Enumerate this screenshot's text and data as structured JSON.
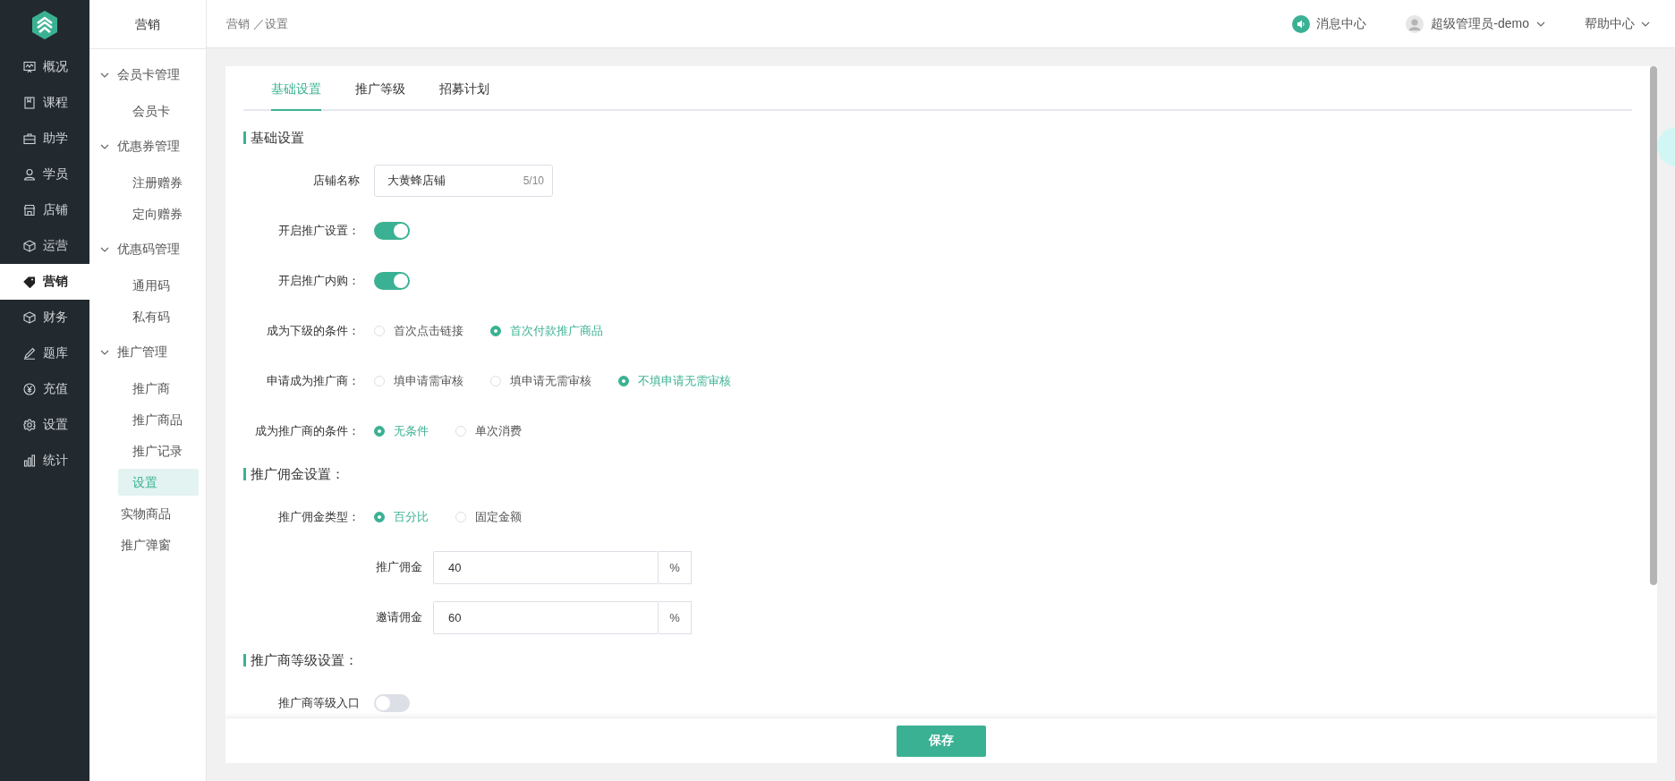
{
  "main_nav": [
    {
      "label": "概况",
      "selected": false
    },
    {
      "label": "课程",
      "selected": false
    },
    {
      "label": "助学",
      "selected": false
    },
    {
      "label": "学员",
      "selected": false
    },
    {
      "label": "店铺",
      "selected": false
    },
    {
      "label": "运营",
      "selected": false
    },
    {
      "label": "营销",
      "selected": true
    },
    {
      "label": "财务",
      "selected": false
    },
    {
      "label": "题库",
      "selected": false
    },
    {
      "label": "充值",
      "selected": false
    },
    {
      "label": "设置",
      "selected": false
    },
    {
      "label": "统计",
      "selected": false
    }
  ],
  "sub_nav": {
    "title": "营销",
    "items": [
      {
        "kind": "group",
        "label": "会员卡管理",
        "expanded": true,
        "children": [
          {
            "label": "会员卡",
            "selected": false
          }
        ]
      },
      {
        "kind": "group",
        "label": "优惠券管理",
        "expanded": true,
        "children": [
          {
            "label": "注册赠券",
            "selected": false
          },
          {
            "label": "定向赠券",
            "selected": false
          }
        ]
      },
      {
        "kind": "group",
        "label": "优惠码管理",
        "expanded": true,
        "children": [
          {
            "label": "通用码",
            "selected": false
          },
          {
            "label": "私有码",
            "selected": false
          }
        ]
      },
      {
        "kind": "group",
        "label": "推广管理",
        "expanded": true,
        "children": [
          {
            "label": "推广商",
            "selected": false
          },
          {
            "label": "推广商品",
            "selected": false
          },
          {
            "label": "推广记录",
            "selected": false
          },
          {
            "label": "设置",
            "selected": true
          }
        ]
      },
      {
        "kind": "link",
        "label": "实物商品",
        "selected": false
      },
      {
        "kind": "link",
        "label": "推广弹窗",
        "selected": false
      }
    ]
  },
  "breadcrumb": "营销 ／设置",
  "header": {
    "messages": "消息中心",
    "user": "超级管理员-demo",
    "help": "帮助中心"
  },
  "tabs": [
    {
      "label": "基础设置",
      "selected": true
    },
    {
      "label": "推广等级",
      "selected": false
    },
    {
      "label": "招募计划",
      "selected": false
    }
  ],
  "sections": [
    {
      "title": "基础设置",
      "fields": [
        {
          "kind": "text",
          "label": "店铺名称",
          "value": "大黄蜂店铺",
          "count": "5/10"
        },
        {
          "kind": "switch",
          "label": "开启推广设置：",
          "on": true
        },
        {
          "kind": "switch",
          "label": "开启推广内购：",
          "on": true
        },
        {
          "kind": "radio",
          "label": "成为下级的条件：",
          "options": [
            {
              "label": "首次点击链接",
              "selected": false
            },
            {
              "label": "首次付款推广商品",
              "selected": true
            }
          ]
        },
        {
          "kind": "radio",
          "label": "申请成为推广商：",
          "options": [
            {
              "label": "填申请需审核",
              "selected": false
            },
            {
              "label": "填申请无需审核",
              "selected": false
            },
            {
              "label": "不填申请无需审核",
              "selected": true
            }
          ]
        },
        {
          "kind": "radio",
          "label": "成为推广商的条件：",
          "options": [
            {
              "label": "无条件",
              "selected": true
            },
            {
              "label": "单次消费",
              "selected": false
            }
          ]
        }
      ]
    },
    {
      "title": "推广佣金设置：",
      "fields": [
        {
          "kind": "radio",
          "label": "推广佣金类型：",
          "options": [
            {
              "label": "百分比",
              "selected": true
            },
            {
              "label": "固定金额",
              "selected": false
            }
          ]
        },
        {
          "kind": "suffix",
          "label": "推广佣金",
          "value": "40",
          "suffix": "%"
        },
        {
          "kind": "suffix",
          "label": "邀请佣金",
          "value": "60",
          "suffix": "%"
        }
      ]
    },
    {
      "title": "推广商等级设置：",
      "fields": [
        {
          "kind": "switch",
          "label": "推广商等级入口",
          "on": false
        }
      ]
    }
  ],
  "save_button": "保存"
}
